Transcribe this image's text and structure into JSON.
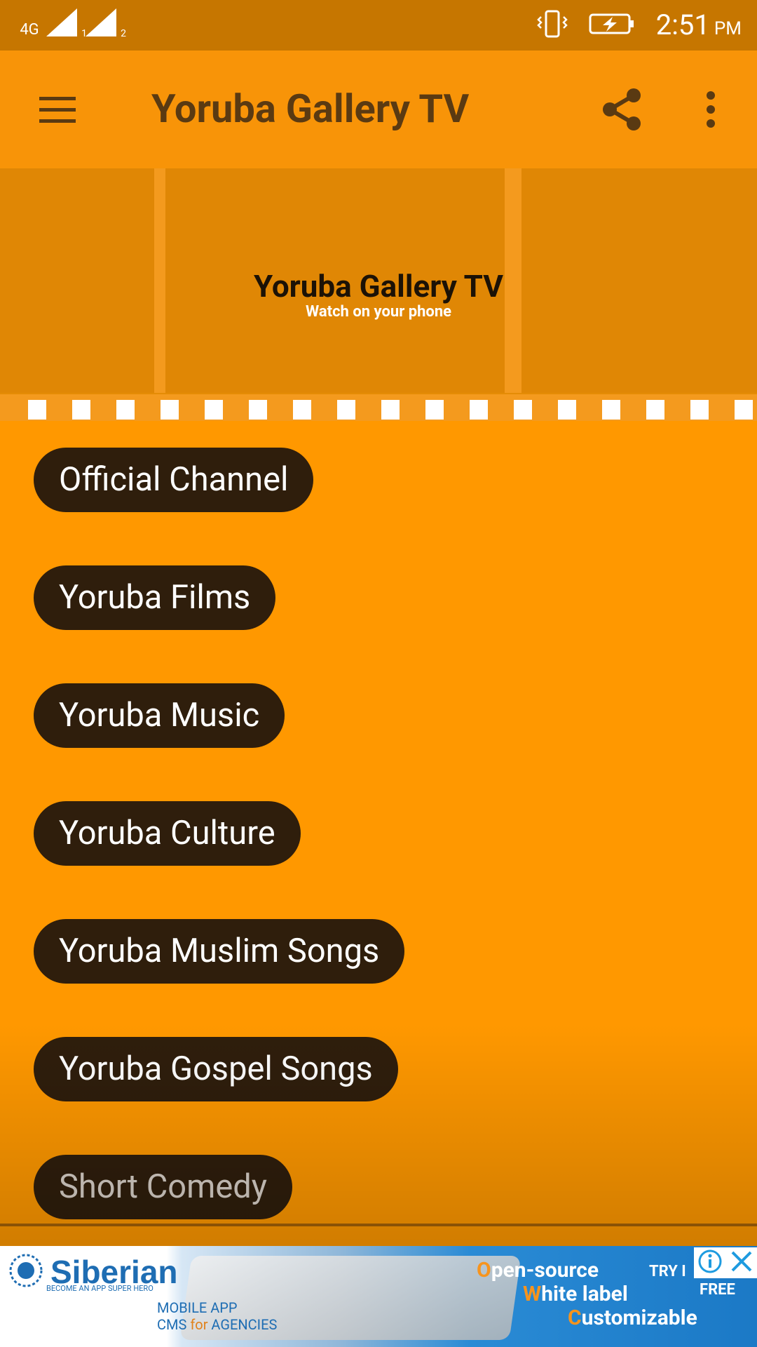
{
  "status_bar": {
    "network": "4G",
    "sim1": "1",
    "sim2": "2",
    "time": "2:51",
    "ampm": "PM"
  },
  "app_bar": {
    "title": "Yoruba Gallery TV",
    "menu_icon": "hamburger-menu-icon",
    "share_icon": "share-icon",
    "more_icon": "more-vert-icon"
  },
  "banner": {
    "title": "Yoruba Gallery TV",
    "subtitle": "Watch on your phone"
  },
  "menu_items": [
    {
      "label": "Official Channel"
    },
    {
      "label": "Yoruba Films"
    },
    {
      "label": "Yoruba Music"
    },
    {
      "label": "Yoruba Culture"
    },
    {
      "label": "Yoruba Muslim Songs"
    },
    {
      "label": "Yoruba Gospel Songs"
    },
    {
      "label": "Short Comedy"
    }
  ],
  "ad": {
    "brand": "Siberian",
    "tagline": "BECOME AN APP SUPER HERO",
    "line1": "MOBILE APP",
    "line2_pre": "CMS ",
    "line2_for": "for",
    "line2_post": " AGENCIES",
    "feature1_cap": "O",
    "feature1_rest": "pen-source",
    "feature2_cap": "W",
    "feature2_rest": "hite label",
    "feature3_cap": "C",
    "feature3_rest": "ustomizable",
    "try": "TRY I",
    "free": "FREE"
  },
  "colors": {
    "status_bar": "#C67600",
    "app_bar": "#F89408",
    "background": "#FF9800",
    "pill": "#2F1E0C",
    "title_text": "#5A3A12"
  }
}
